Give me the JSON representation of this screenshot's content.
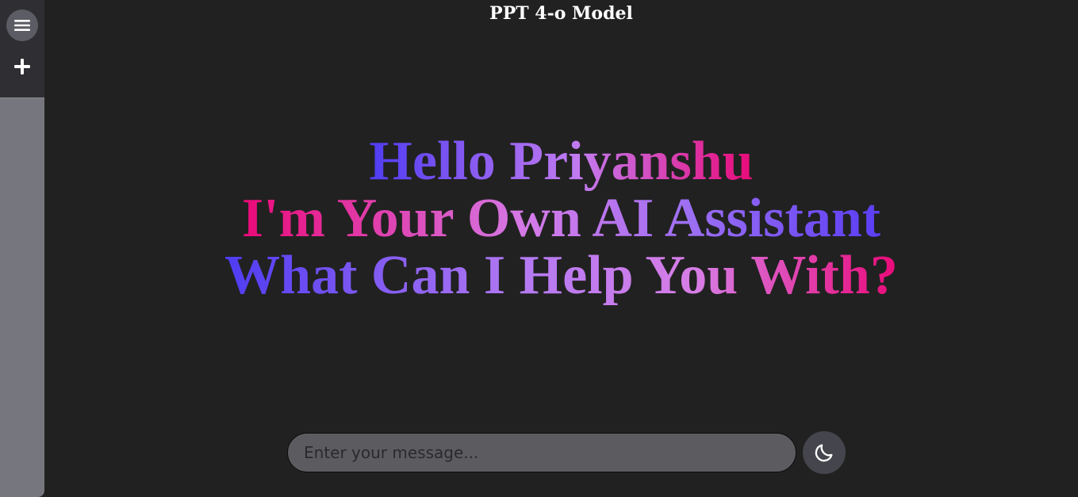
{
  "header": {
    "title": "PPT 4-o Model"
  },
  "sidebar": {
    "menu_icon": "hamburger-menu-icon",
    "new_chat_icon": "plus-icon"
  },
  "hero": {
    "line1": "Hello Priyanshu",
    "line2": "I'm Your Own AI Assistant",
    "line3": "What Can I Help You With?"
  },
  "composer": {
    "placeholder": "Enter your message...",
    "value": ""
  },
  "theme_toggle": {
    "icon": "moon-icon"
  },
  "colors": {
    "background": "#212121",
    "sidebar": "#76767e",
    "gradient_blue": "#4f3cf2",
    "gradient_violet": "#c37bf0",
    "gradient_pink": "#ea0a78"
  }
}
